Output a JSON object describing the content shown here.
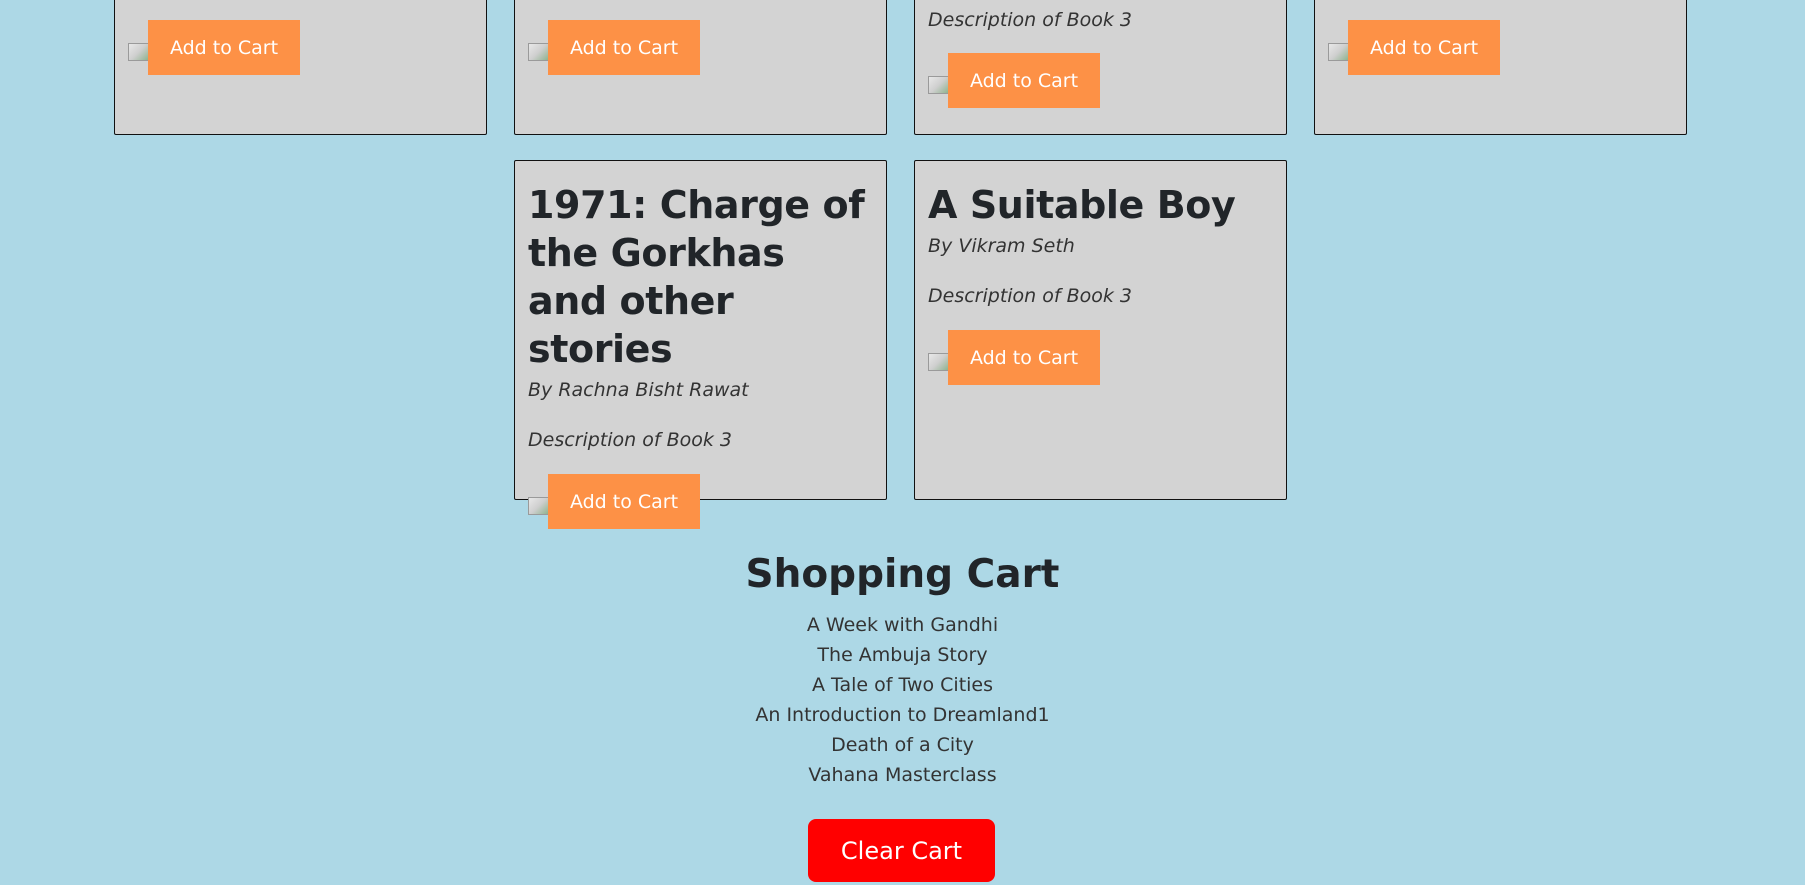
{
  "top_row": [
    {
      "description": "",
      "button_label": "Add to Cart"
    },
    {
      "description": "",
      "button_label": "Add to Cart"
    },
    {
      "description": "Description of Book 3",
      "button_label": "Add to Cart"
    },
    {
      "description": "",
      "button_label": "Add to Cart"
    }
  ],
  "books": [
    {
      "title": "1971: Charge of the Gorkhas and other stories",
      "author": "By Rachna Bisht Rawat",
      "description": "Description of Book 3",
      "button_label": "Add to Cart"
    },
    {
      "title": "A Suitable Boy",
      "author": "By Vikram Seth",
      "description": "Description of Book 3",
      "button_label": "Add to Cart"
    }
  ],
  "cart": {
    "title": "Shopping Cart",
    "items": [
      "A Week with Gandhi",
      "The Ambuja Story",
      "A Tale of Two Cities",
      "An Introduction to Dreamland1",
      "Death of a City",
      "Vahana Masterclass"
    ],
    "clear_label": "Clear Cart"
  },
  "colors": {
    "page_background": "#add8e6",
    "card_background": "#d3d3d3",
    "add_button": "#fd9146",
    "clear_button": "#ff0000"
  }
}
